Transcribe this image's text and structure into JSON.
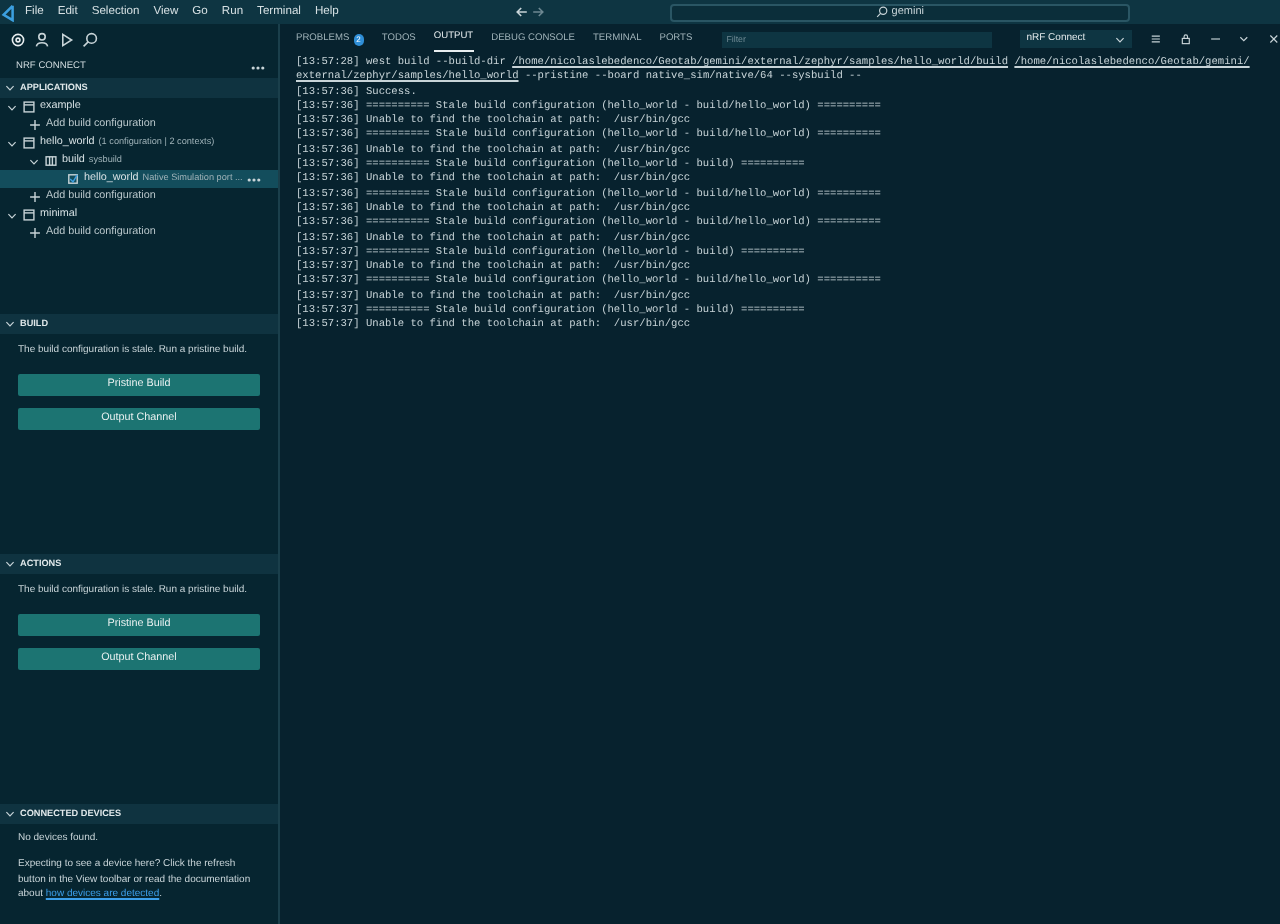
{
  "menu": [
    "File",
    "Edit",
    "Selection",
    "View",
    "Go",
    "Run",
    "Terminal",
    "Help"
  ],
  "search": {
    "value": "gemini"
  },
  "sidebar": {
    "title": "NRF CONNECT",
    "applications": {
      "title": "APPLICATIONS",
      "expanded": true,
      "items": [
        {
          "kind": "app",
          "label": "example",
          "expanded": true,
          "selected": false,
          "children": [
            {
              "kind": "add",
              "label": "Add build configuration",
              "selected": false
            }
          ]
        },
        {
          "kind": "app",
          "label": "hello_world",
          "detail": "(1 configuration | 2 contexts)",
          "expanded": true,
          "selected": false,
          "children": [
            {
              "kind": "build",
              "label": "build",
              "detail": "sysbuild",
              "expanded": true,
              "selected": false,
              "children": [
                {
                  "kind": "target",
                  "label": "hello_world",
                  "detail": "Native Simulation port ...",
                  "selected": true
                }
              ]
            },
            {
              "kind": "add",
              "label": "Add build configuration",
              "selected": false
            }
          ]
        },
        {
          "kind": "app",
          "label": "minimal",
          "expanded": true,
          "selected": false,
          "children": [
            {
              "kind": "add",
              "label": "Add build configuration",
              "selected": false
            }
          ]
        }
      ]
    },
    "build": {
      "title": "BUILD",
      "expanded": true,
      "message": "The build configuration is stale. Run a pristine build.",
      "buttons": [
        "Pristine Build",
        "Output Channel"
      ]
    },
    "actions": {
      "title": "ACTIONS",
      "expanded": true,
      "message": "The build configuration is stale. Run a pristine build.",
      "buttons": [
        "Pristine Build",
        "Output Channel"
      ]
    },
    "devices": {
      "title": "CONNECTED DEVICES",
      "expanded": true,
      "empty": "No devices found.",
      "help": "Expecting to see a device here? Click the refresh button in the View toolbar or read the documentation about ",
      "link": "how devices are detected",
      "after": "."
    }
  },
  "panel": {
    "tabs": [
      {
        "label": "PROBLEMS",
        "badge": "2",
        "selected": false
      },
      {
        "label": "TODOS",
        "selected": false
      },
      {
        "label": "OUTPUT",
        "selected": true
      },
      {
        "label": "DEBUG CONSOLE",
        "selected": false
      },
      {
        "label": "TERMINAL",
        "selected": false
      },
      {
        "label": "PORTS",
        "selected": false
      }
    ],
    "filter": {
      "placeholder": "Filter"
    },
    "channel": "nRF Connect",
    "output": [
      {
        "time": "[13:57:28]",
        "parts": [
          {
            "t": "west build --build-dir "
          },
          {
            "t": "/home/nicolaslebedenco/Geotab/gemini/external/zephyr/samples/hello_world/build",
            "link": true
          },
          {
            "t": "/home/nicolaslebedenco/Geotab/gemini/",
            "link": true
          }
        ]
      },
      {
        "parts": [
          {
            "t": "external/zephyr/samples/hello_world",
            "link": true
          },
          {
            "t": " --pristine --board native_sim/native/64 --sysbuild --"
          }
        ]
      },
      {
        "time": "[13:57:36]",
        "parts": [
          {
            "t": "Success."
          }
        ]
      },
      {
        "time": "[13:57:36]",
        "parts": [
          {
            "t": "========== Stale build configuration (hello_world - build/hello_world) =========="
          }
        ]
      },
      {
        "time": "[13:57:36]",
        "parts": [
          {
            "t": "Unable to find the toolchain at path:  /usr/bin/gcc"
          }
        ]
      },
      {
        "time": "[13:57:36]",
        "parts": [
          {
            "t": "========== Stale build configuration (hello_world - build/hello_world) =========="
          }
        ]
      },
      {
        "time": "[13:57:36]",
        "parts": [
          {
            "t": "Unable to find the toolchain at path:  /usr/bin/gcc"
          }
        ]
      },
      {
        "time": "[13:57:36]",
        "parts": [
          {
            "t": "========== Stale build configuration (hello_world - build) =========="
          }
        ]
      },
      {
        "time": "[13:57:36]",
        "parts": [
          {
            "t": "Unable to find the toolchain at path:  /usr/bin/gcc"
          }
        ]
      },
      {
        "time": "[13:57:36]",
        "parts": [
          {
            "t": "========== Stale build configuration (hello_world - build/hello_world) =========="
          }
        ]
      },
      {
        "time": "[13:57:36]",
        "parts": [
          {
            "t": "Unable to find the toolchain at path:  /usr/bin/gcc"
          }
        ]
      },
      {
        "time": "[13:57:36]",
        "parts": [
          {
            "t": "========== Stale build configuration (hello_world - build/hello_world) =========="
          }
        ]
      },
      {
        "time": "[13:57:36]",
        "parts": [
          {
            "t": "Unable to find the toolchain at path:  /usr/bin/gcc"
          }
        ]
      },
      {
        "time": "[13:57:37]",
        "parts": [
          {
            "t": "========== Stale build configuration (hello_world - build) =========="
          }
        ]
      },
      {
        "time": "[13:57:37]",
        "parts": [
          {
            "t": "Unable to find the toolchain at path:  /usr/bin/gcc"
          }
        ]
      },
      {
        "time": "[13:57:37]",
        "parts": [
          {
            "t": "========== Stale build configuration (hello_world - build/hello_world) =========="
          }
        ]
      },
      {
        "time": "[13:57:37]",
        "parts": [
          {
            "t": "Unable to find the toolchain at path:  /usr/bin/gcc"
          }
        ]
      },
      {
        "time": "[13:57:37]",
        "parts": [
          {
            "t": "========== Stale build configuration (hello_world - build) =========="
          }
        ]
      },
      {
        "time": "[13:57:37]",
        "parts": [
          {
            "t": "Unable to find the toolchain at path:  /usr/bin/gcc"
          }
        ]
      }
    ]
  }
}
